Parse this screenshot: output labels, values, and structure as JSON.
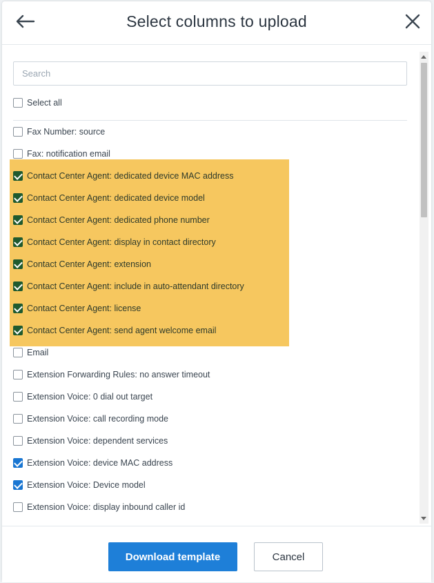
{
  "header": {
    "title": "Select columns to upload"
  },
  "search": {
    "placeholder": "Search",
    "value": ""
  },
  "select_all": {
    "label": "Select all",
    "checked": false
  },
  "columns": [
    {
      "label": "Fax Number: source",
      "checked": false,
      "highlighted": false
    },
    {
      "label": "Fax: notification email",
      "checked": false,
      "highlighted": false
    },
    {
      "label": "Contact Center Agent: dedicated device MAC address",
      "checked": true,
      "highlighted": true
    },
    {
      "label": "Contact Center Agent: dedicated device model",
      "checked": true,
      "highlighted": true
    },
    {
      "label": "Contact Center Agent: dedicated phone number",
      "checked": true,
      "highlighted": true
    },
    {
      "label": "Contact Center Agent: display in contact directory",
      "checked": true,
      "highlighted": true
    },
    {
      "label": "Contact Center Agent: extension",
      "checked": true,
      "highlighted": true
    },
    {
      "label": "Contact Center Agent: include in auto-attendant directory",
      "checked": true,
      "highlighted": true
    },
    {
      "label": "Contact Center Agent: license",
      "checked": true,
      "highlighted": true
    },
    {
      "label": "Contact Center Agent: send agent welcome email",
      "checked": true,
      "highlighted": true
    },
    {
      "label": "Email",
      "checked": false,
      "highlighted": false
    },
    {
      "label": "Extension Forwarding Rules: no answer timeout",
      "checked": false,
      "highlighted": false
    },
    {
      "label": "Extension Voice: 0 dial out target",
      "checked": false,
      "highlighted": false
    },
    {
      "label": "Extension Voice: call recording mode",
      "checked": false,
      "highlighted": false
    },
    {
      "label": "Extension Voice: dependent services",
      "checked": false,
      "highlighted": false
    },
    {
      "label": "Extension Voice: device MAC address",
      "checked": true,
      "highlighted": false
    },
    {
      "label": "Extension Voice: Device model",
      "checked": true,
      "highlighted": false
    },
    {
      "label": "Extension Voice: display inbound caller id",
      "checked": false,
      "highlighted": false
    }
  ],
  "footer": {
    "download_label": "Download template",
    "cancel_label": "Cancel"
  },
  "colors": {
    "primary": "#1e7fd8",
    "highlight": "#f6c456",
    "checked_in_highlight": "#1f5a2f"
  },
  "icons": {
    "back": "arrow-left-icon",
    "close": "close-icon"
  }
}
